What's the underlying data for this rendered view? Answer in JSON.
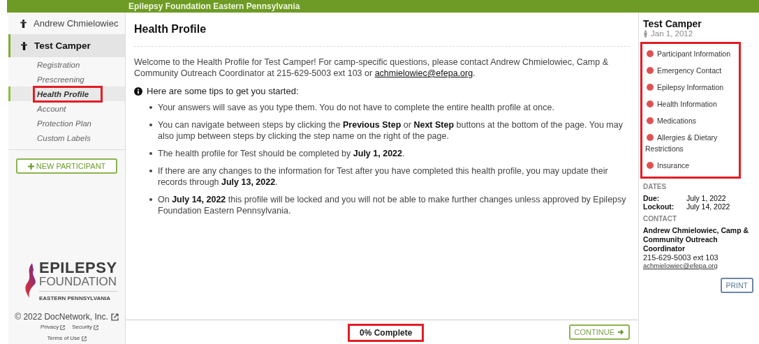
{
  "banner": {
    "title": "Epilepsy Foundation Eastern Pennsylvania"
  },
  "sidebar": {
    "account": "Andrew Chmielowiec",
    "participant": {
      "name": "Test Camper",
      "selected": true
    },
    "items": [
      {
        "label": "Registration",
        "selected": false,
        "highlighted": false
      },
      {
        "label": "Prescreening",
        "selected": false,
        "highlighted": false
      },
      {
        "label": "Health Profile",
        "selected": true,
        "highlighted": true
      },
      {
        "label": "Account",
        "selected": false,
        "highlighted": false
      },
      {
        "label": "Protection Plan",
        "selected": false,
        "highlighted": false
      },
      {
        "label": "Custom Labels",
        "selected": false,
        "highlighted": false
      }
    ],
    "new_button": "NEW PARTICIPANT",
    "logo": {
      "line1": "EPILEPSY",
      "line2": "FOUNDATION",
      "line3": "EASTERN PENNSYLVANIA"
    },
    "footer": {
      "copyright": "© 2022 DocNetwork, Inc.",
      "links": [
        "Privacy",
        "Security",
        "Terms of Use"
      ]
    }
  },
  "main": {
    "title": "Health Profile",
    "intro": "Welcome to the Health Profile for Test Camper! For camp-specific questions, please contact Andrew Chmielowiec, Camp & Community Outreach Coordinator at 215-629-5003 ext 103 or",
    "intro_link": "achmielowiec@efepa.org",
    "intro_end": ".",
    "tips_heading": "Here are some tips to get you started:",
    "tips": [
      "Your answers will save as you type them. You do not have to complete the entire health profile at once.",
      "You can navigate between steps by clicking the **Previous Step** or **Next Step** buttons at the bottom of the page. You may also jump between steps by clicking the step name on the right of the page.",
      "The health profile for Test should be completed by **July 1, 2022**.",
      "If there are any changes to the information for Test after you have completed this health profile, you may update their records through **July 13, 2022**.",
      "On **July 14, 2022** this profile will be locked and you will not be able to make further changes unless approved by Epilepsy Foundation Eastern Pennsylvania."
    ],
    "progress": {
      "label": "0% Complete",
      "highlighted": true
    },
    "continue_button": "CONTINUE"
  },
  "right": {
    "name": "Test Camper",
    "dob": "Jan 1, 2012",
    "steps_highlighted": true,
    "steps": [
      {
        "label": "Participant Information",
        "complete": false
      },
      {
        "label": "Emergency Contact",
        "complete": false
      },
      {
        "label": "Epilepsy Information",
        "complete": false
      },
      {
        "label": "Health Information",
        "complete": false
      },
      {
        "label": "Medications",
        "complete": false
      },
      {
        "label": "Allergies & Dietary Restrictions",
        "complete": false
      },
      {
        "label": "Insurance",
        "complete": false
      }
    ],
    "dates_heading": "DATES",
    "dates": [
      {
        "label": "Due:",
        "value": "July 1, 2022"
      },
      {
        "label": "Lockout:",
        "value": "July 14, 2022"
      }
    ],
    "contact_heading": "CONTACT",
    "contact_name": "Andrew Chmielowiec, Camp & Community Outreach Coordinator",
    "contact_phone": "215-629-5003 ext 103",
    "contact_email": "achmielowiec@efepa.org",
    "print_button": "PRINT"
  }
}
